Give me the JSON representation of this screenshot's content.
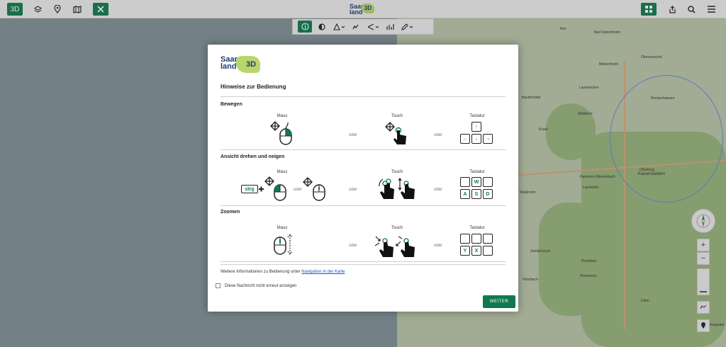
{
  "topbar": {
    "btn_3d": "3D",
    "brand_top": "Saar",
    "brand_bottom": "land",
    "brand_badge": "3D",
    "accent": "#0f7a4f"
  },
  "map_labels": {
    "kirn": "Kirn",
    "bad_sobernheim": "Bad Sobernheim",
    "obermoschel": "Obermoschel",
    "meisenheim": "Meisenheim",
    "lauterecken": "Lauterecken",
    "baumholder": "Baumholder",
    "wolfstein": "Wolfstein",
    "kusel": "Kusel",
    "rockenhausen": "Rockenhausen",
    "otterberg": "Otterberg",
    "ramstein": "Ramstein-Miesenbach",
    "kaiserslautern": "Kaiserslautern",
    "landstuhl": "Landstuhl",
    "waldmohr": "Waldmohr",
    "zweibruecken": "Zweibrücken",
    "rodalben": "Rodalben",
    "pirmasens": "Pirmasens",
    "hornbach": "Hornbach",
    "dahn": "Dahn",
    "bergzabern": "Bergzabe"
  },
  "modal": {
    "logo_top": "Saar",
    "logo_bottom": "land",
    "logo_badge": "3D",
    "title": "Hinweise zur Bedienung",
    "sections": [
      {
        "title": "Bewegen",
        "col1": "Maus",
        "col2": "Touch",
        "col3": "Tastatur"
      },
      {
        "title": "Ansicht drehen und neigen",
        "col1": "Maus",
        "col2": "Touch",
        "col3": "Tastatur",
        "strg": "strg",
        "keys": [
          "W",
          "A",
          "S",
          "D"
        ]
      },
      {
        "title": "Zoomen",
        "col1": "Maus",
        "col2": "Touch",
        "col3": "Tastatur",
        "keys": [
          "Y",
          "X"
        ]
      }
    ],
    "oder": "oder",
    "info_text": "Weitere Informationen zu Bedienung unter ",
    "info_link": "Navigation in der Karte",
    "checkbox_label": "Diese Nachricht nicht erneut anzeigen",
    "weiter": "WEITER"
  },
  "controls": {
    "zoom_in": "+",
    "zoom_out": "−",
    "compass_n": "N"
  },
  "icons": [
    "layers-icon",
    "location-pin-icon",
    "map-book-icon",
    "tools-icon",
    "grid-icon",
    "share-icon",
    "search-icon",
    "menu-icon",
    "info-icon",
    "shading-icon",
    "measure-icon",
    "profile-icon",
    "angle-icon",
    "chart-icon",
    "pencil-icon",
    "compass-icon",
    "globe-icon",
    "pin-icon"
  ]
}
